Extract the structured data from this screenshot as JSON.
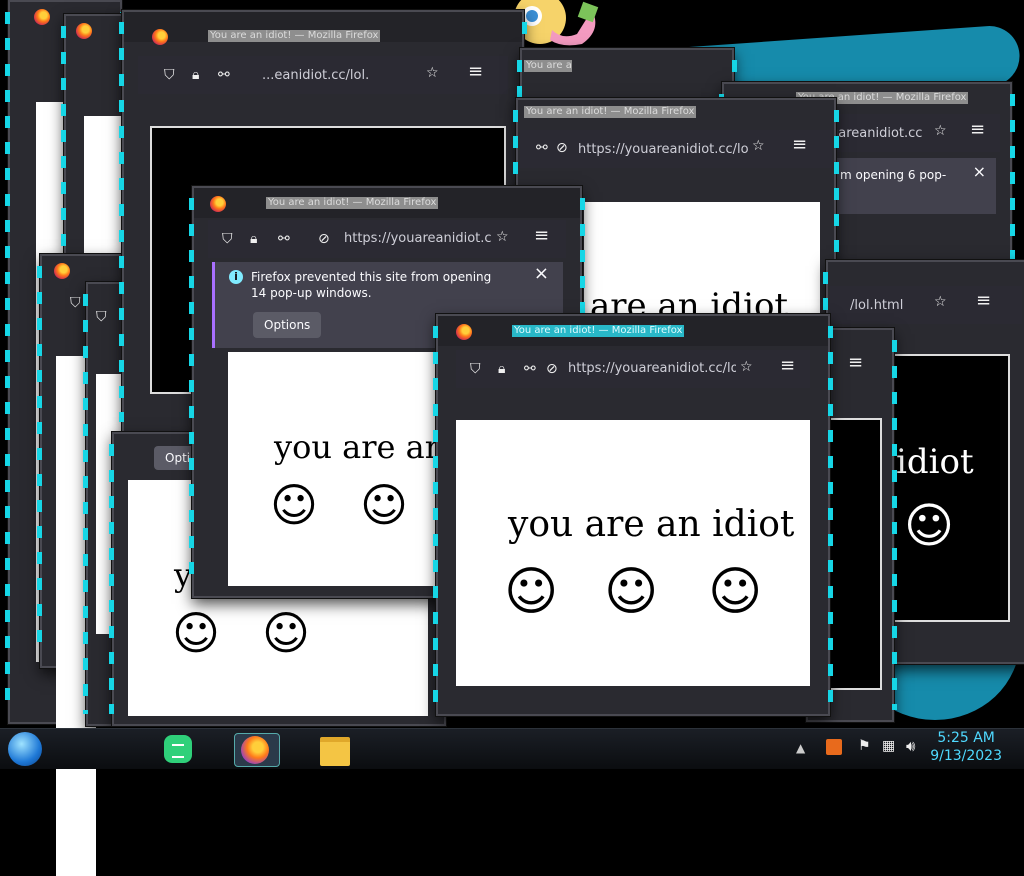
{
  "browser": {
    "title": "You are an idiot! — Mozilla Firefox",
    "url": "https://youareanidiot.cc/lol.html",
    "url_truncated": "https://youareanidiot.cc/lol.",
    "url_partial_a": "https://youareanidiot.cc",
    "url_partial_b": "...eanidiot.cc/lol.",
    "url_partial_c": "uareanidiot.cc",
    "url_partial_d": "/lol.html",
    "url_partial_e": "h",
    "menu_icon": "≡"
  },
  "page": {
    "headline": "you are an idiot",
    "headline_cut": "you are an",
    "headline_tail": "idiot",
    "headline_mid": "are an idiot",
    "headline_first": "y",
    "smiley": "☺"
  },
  "notification": {
    "message": "Firefox prevented this site from opening 14 pop-up windows.",
    "message_partial": "m opening 6 pop-",
    "options_label": "Options",
    "options_partial": "Optio",
    "close_icon": "×"
  },
  "taskbar": {
    "time": "5:25 AM",
    "date": "9/13/2023",
    "apps": [
      "start-orb",
      "notes-app",
      "firefox",
      "file-explorer"
    ]
  },
  "colors": {
    "accent_cyan": "#16d6e6",
    "window_chrome": "#2a2a30",
    "firefox_bar": "#2b2a33",
    "notification_bg": "#42414d",
    "clock": "#4fd9ff"
  }
}
